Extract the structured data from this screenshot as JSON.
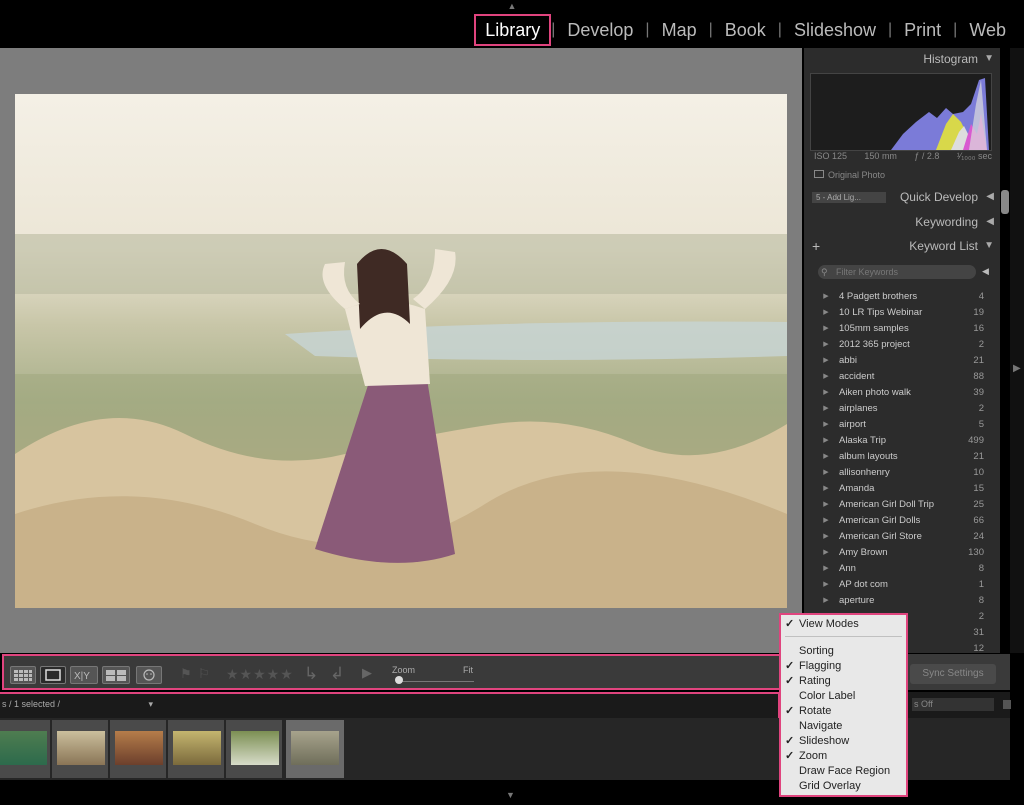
{
  "modules": [
    {
      "label": "Library",
      "active": true
    },
    {
      "label": "Develop"
    },
    {
      "label": "Map"
    },
    {
      "label": "Book"
    },
    {
      "label": "Slideshow"
    },
    {
      "label": "Print"
    },
    {
      "label": "Web"
    }
  ],
  "right_panel": {
    "histogram": {
      "title": "Histogram",
      "iso": "ISO 125",
      "focal": "150 mm",
      "aperture": "ƒ / 2.8",
      "shutter": "¹⁄₁₀₀₀ sec",
      "original_photo": "Original Photo"
    },
    "quick_develop": {
      "title": "Quick Develop",
      "preset": "5 - Add Lig..."
    },
    "keywording": {
      "title": "Keywording"
    },
    "keyword_list": {
      "title": "Keyword List",
      "add": "+",
      "filter_placeholder": "Filter Keywords",
      "items": [
        {
          "name": "4 Padgett brothers",
          "count": "4"
        },
        {
          "name": "10 LR Tips Webinar",
          "count": "19"
        },
        {
          "name": "105mm samples",
          "count": "16"
        },
        {
          "name": "2012 365 project",
          "count": "2"
        },
        {
          "name": "abbi",
          "count": "21"
        },
        {
          "name": "accident",
          "count": "88"
        },
        {
          "name": "Aiken photo walk",
          "count": "39"
        },
        {
          "name": "airplanes",
          "count": "2"
        },
        {
          "name": "airport",
          "count": "5"
        },
        {
          "name": "Alaska Trip",
          "count": "499"
        },
        {
          "name": "album layouts",
          "count": "21"
        },
        {
          "name": "allisonhenry",
          "count": "10"
        },
        {
          "name": "Amanda",
          "count": "15"
        },
        {
          "name": "American Girl Doll Trip",
          "count": "25"
        },
        {
          "name": "American Girl Dolls",
          "count": "66"
        },
        {
          "name": "American Girl Store",
          "count": "24"
        },
        {
          "name": "Amy Brown",
          "count": "130"
        },
        {
          "name": "Ann",
          "count": "8"
        },
        {
          "name": "AP dot com",
          "count": "1"
        },
        {
          "name": "aperture",
          "count": "8"
        },
        {
          "name": "",
          "count": "2"
        },
        {
          "name": "p",
          "count": "31"
        },
        {
          "name": "p",
          "count": "12"
        }
      ]
    },
    "sync_button": "Sync Settings"
  },
  "toolbar": {
    "zoom_label": "Zoom",
    "fit_label": "Fit",
    "stars": "★★★★★"
  },
  "filmstrip": {
    "selection_info": "s / 1 selected /",
    "filter": "s Off"
  },
  "context_menu": {
    "items": [
      {
        "label": "View Modes",
        "checked": true
      },
      {
        "label": "Sorting",
        "checked": false
      },
      {
        "label": "Flagging",
        "checked": true
      },
      {
        "label": "Rating",
        "checked": true
      },
      {
        "label": "Color Label",
        "checked": false
      },
      {
        "label": "Rotate",
        "checked": true
      },
      {
        "label": "Navigate",
        "checked": false
      },
      {
        "label": "Slideshow",
        "checked": true
      },
      {
        "label": "Zoom",
        "checked": true
      },
      {
        "label": "Draw Face Region",
        "checked": false
      },
      {
        "label": "Grid Overlay",
        "checked": false
      }
    ]
  },
  "colors": {
    "highlight": "#e0447e",
    "panel_bg": "#2c2c2c",
    "center_bg": "#7d7d7d"
  }
}
